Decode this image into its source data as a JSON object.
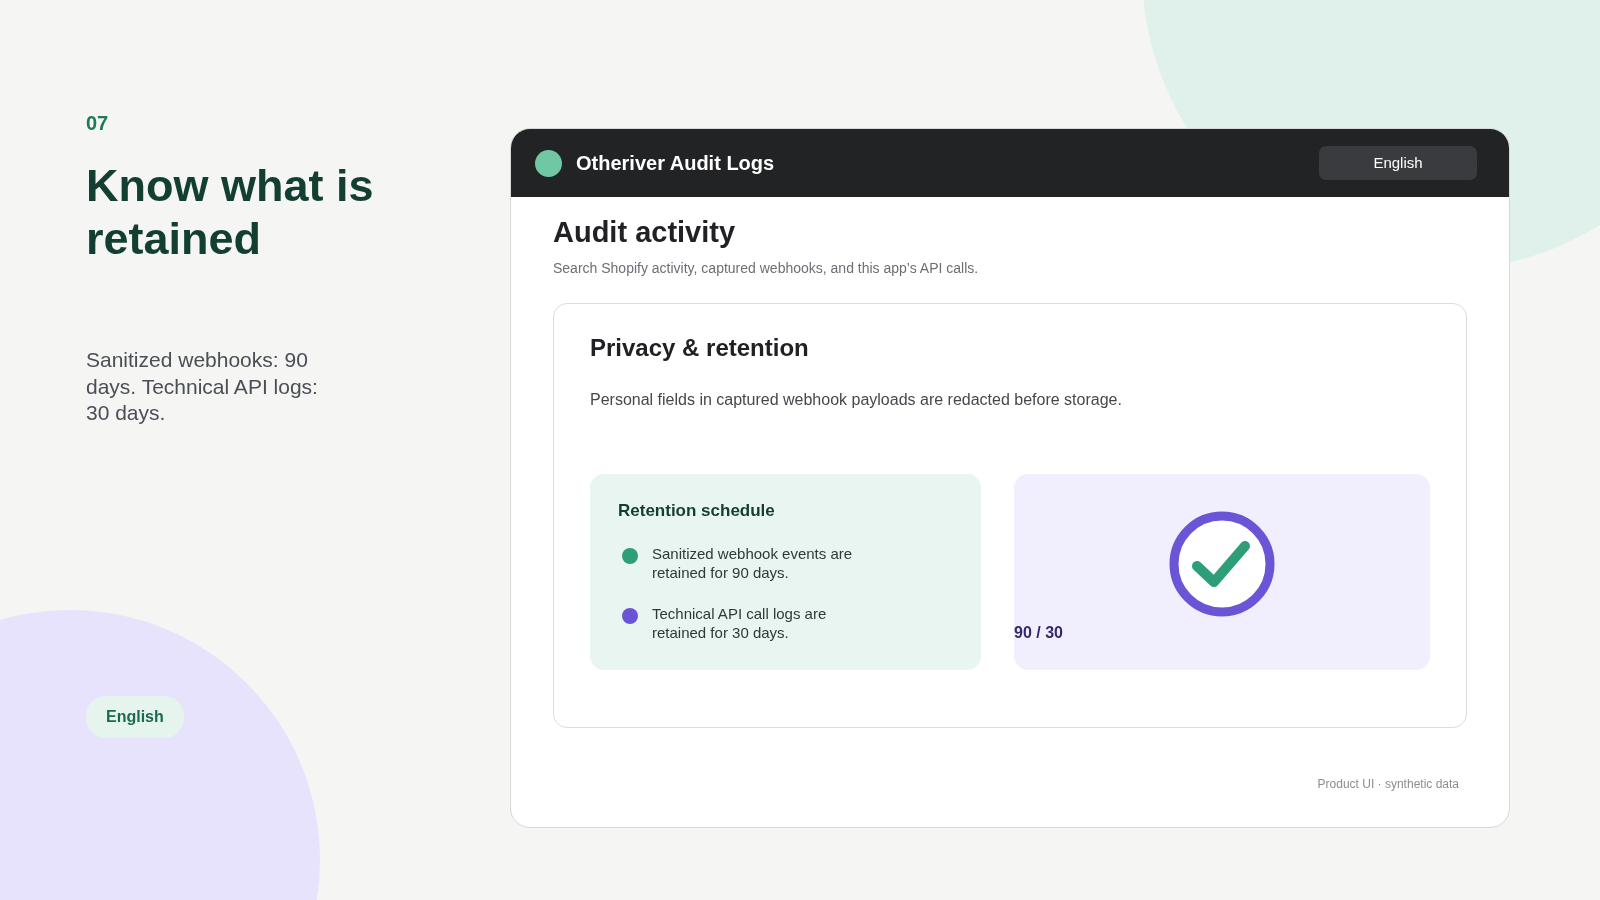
{
  "slide": {
    "number": "07",
    "headline": "Know what is retained",
    "summary": "Sanitized webhooks: 90 days. Technical API logs: 30 days.",
    "language_pill": "English"
  },
  "window": {
    "title": "Otheriver Audit Logs",
    "language_button": "English"
  },
  "page": {
    "heading": "Audit activity",
    "subtitle": "Search Shopify activity, captured webhooks, and this app’s API calls."
  },
  "card": {
    "title": "Privacy & retention",
    "text": "Personal fields in captured webhook payloads are redacted before storage.",
    "schedule": {
      "title": "Retention schedule",
      "items": [
        {
          "text": "Sanitized webhook events are retained for 90 days.",
          "color": "#2e9e78"
        },
        {
          "text": "Technical API call logs are retained for 30 days.",
          "color": "#6b55d6"
        }
      ]
    },
    "summary_label": "90 / 30"
  },
  "footer": "Product UI · synthetic data"
}
